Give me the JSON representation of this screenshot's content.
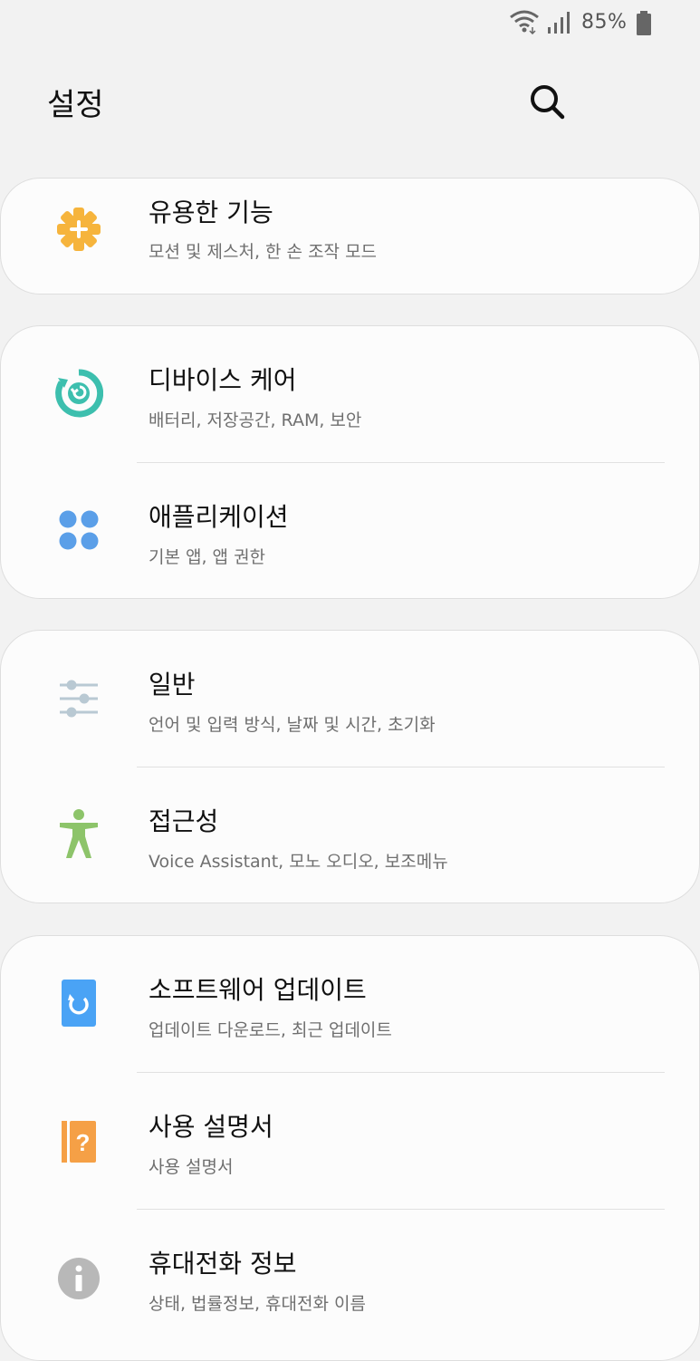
{
  "status_bar": {
    "battery_text": "85%"
  },
  "header": {
    "title": "설정",
    "search_icon": "search-icon"
  },
  "colors": {
    "useful": "#f6b43c",
    "care": "#3dbfae",
    "apps": "#5b9fe8",
    "general": "#b9c9d3",
    "accessibility": "#8dc46a",
    "update": "#4aa3f5",
    "manual": "#f5a046",
    "info": "#b8b8b8"
  },
  "cards": [
    {
      "items": [
        {
          "label": "유용한 기능",
          "sub": "모션 및 제스처, 한 손 조작 모드",
          "icon": "gear-plus-icon"
        }
      ]
    },
    {
      "items": [
        {
          "label": "디바이스 케어",
          "sub": "배터리, 저장공간, RAM, 보안",
          "icon": "device-care-icon"
        },
        {
          "label": "애플리케이션",
          "sub": "기본 앱, 앱 권한",
          "icon": "apps-icon"
        }
      ]
    },
    {
      "items": [
        {
          "label": "일반",
          "sub": "언어 및 입력 방식, 날짜 및 시간, 초기화",
          "icon": "sliders-icon"
        },
        {
          "label": "접근성",
          "sub": "Voice Assistant, 모노 오디오, 보조메뉴",
          "icon": "accessibility-icon"
        }
      ]
    },
    {
      "items": [
        {
          "label": "소프트웨어 업데이트",
          "sub": "업데이트 다운로드, 최근 업데이트",
          "icon": "software-update-icon"
        },
        {
          "label": "사용 설명서",
          "sub": "사용 설명서",
          "icon": "user-manual-icon"
        },
        {
          "label": "휴대전화 정보",
          "sub": "상태, 법률정보, 휴대전화 이름",
          "icon": "info-icon"
        }
      ]
    }
  ]
}
